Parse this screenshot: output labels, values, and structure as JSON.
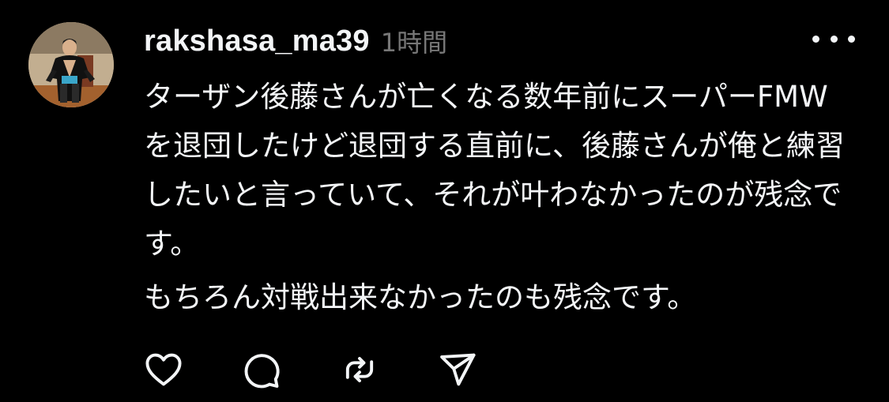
{
  "post": {
    "username": "rakshasa_ma39",
    "timestamp": "1時間",
    "paragraphs": [
      "ターザン後藤さんが亡くなる数年前にスーパーFMW を退団したけど退団する直前に、後藤さんが俺と練習したいと言っていて、それが叶わなかったのが残念です。",
      "もちろん対戦出来なかったのも残念です。"
    ]
  },
  "actions": [
    {
      "name": "like",
      "icon": "heart-icon"
    },
    {
      "name": "reply",
      "icon": "comment-icon"
    },
    {
      "name": "repost",
      "icon": "repost-icon"
    },
    {
      "name": "share",
      "icon": "send-icon"
    }
  ],
  "colors": {
    "background": "#000000",
    "text": "#f3f5f7",
    "secondary": "#777777"
  }
}
